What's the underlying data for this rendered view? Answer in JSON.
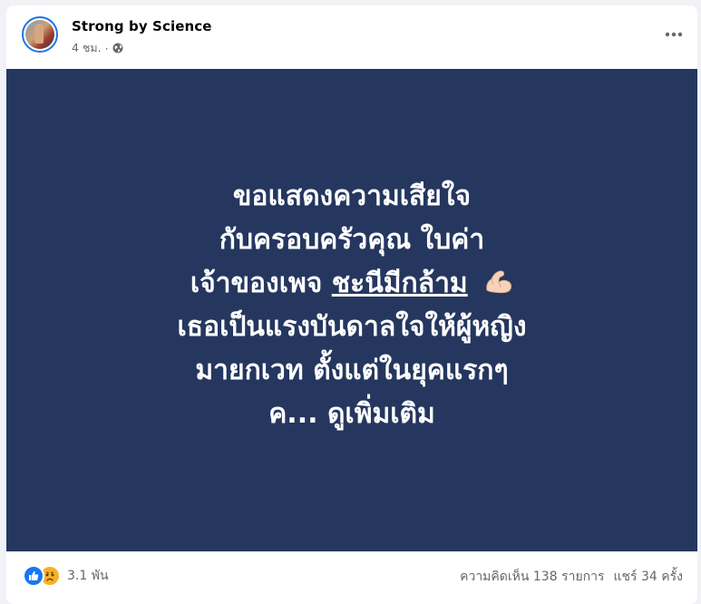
{
  "post": {
    "page_name": "Strong by Science",
    "time": "4 ชม.",
    "separator": "·",
    "privacy_icon": "globe-icon",
    "more_icon": "more-horizontal-icon",
    "background_color": "#25375f",
    "text_lines": [
      "ขอแสดงความเสียใจ",
      "กับครอบครัวคุณ ใบค่า",
      "เจ้าของเพจ",
      "เธอเป็นแรงบันดาลใจให้ผู้หญิง",
      "มายกเวท ตั้งแต่ในยุคแรกๆ",
      "ค..."
    ],
    "mention_link": "ชะนีมีกล้าม",
    "emoji": "flexed-biceps-icon",
    "see_more": "ดูเพิ่มเติม"
  },
  "footer": {
    "reaction_icons": [
      "like-icon",
      "sad-icon"
    ],
    "reaction_count": "3.1 พัน",
    "comments": "ความคิดเห็น 138 รายการ",
    "shares": "แชร์ 34 ครั้ง"
  },
  "colors": {
    "accent": "#1877f2",
    "text_secondary": "#65676b"
  }
}
